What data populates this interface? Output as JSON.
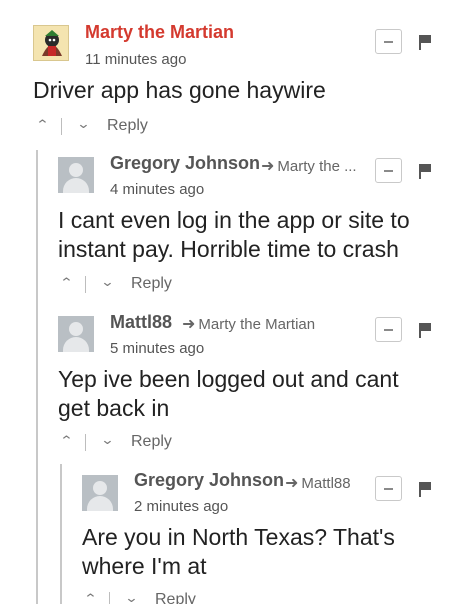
{
  "comments": [
    {
      "author": "Marty the Martian",
      "timestamp": "11 minutes ago",
      "text": "Driver app has gone haywire",
      "reply_label": "Reply"
    },
    {
      "author": "Gregory Johnson",
      "reply_to": "Marty the ...",
      "timestamp": "4 minutes ago",
      "text_lines": [
        "I cant even log in the app or site to",
        "instant pay. Horrible time to crash"
      ],
      "reply_label": "Reply"
    },
    {
      "author": "Mattl88",
      "reply_to": "Marty the Martian",
      "timestamp": "5 minutes ago",
      "text_lines": [
        "Yep ive been logged out and cant",
        "get back in"
      ],
      "reply_label": "Reply"
    },
    {
      "author": "Gregory Johnson",
      "reply_to": "Mattl88",
      "timestamp": "2 minutes ago",
      "text_lines": [
        "Are you in North Texas? That's",
        "where I'm at"
      ],
      "reply_label": "Reply"
    }
  ],
  "icons": {
    "upvote": "chevron-up-icon",
    "downvote": "chevron-down-icon",
    "collapse": "minus-icon",
    "flag": "flag-icon",
    "reply_arrow": "reply-arrow-icon"
  },
  "colors": {
    "op_author": "#d43a2f",
    "author": "#555555",
    "thread_line": "#c8c8c8"
  }
}
